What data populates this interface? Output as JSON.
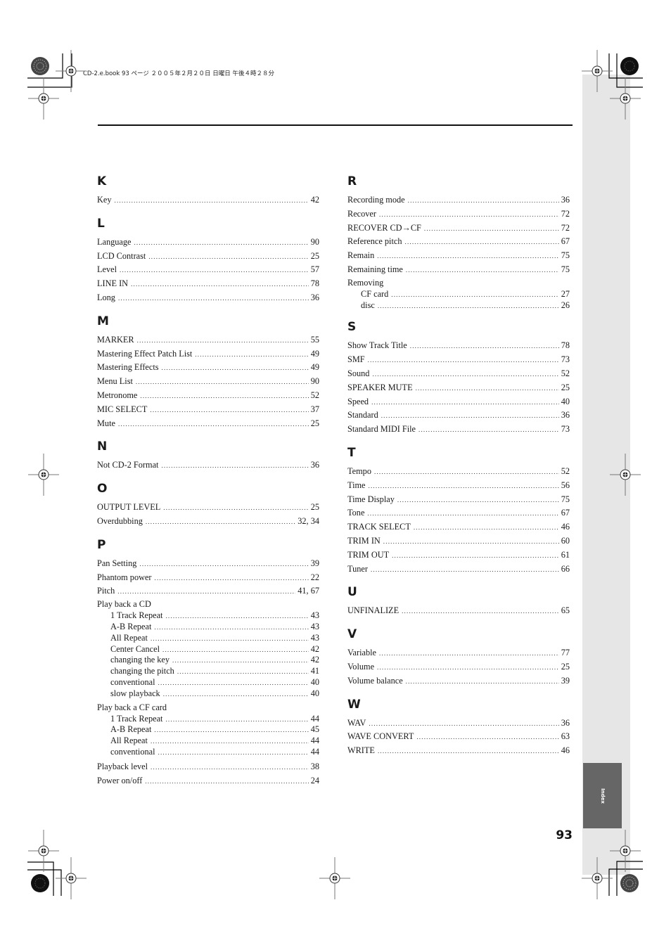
{
  "header": {
    "print_info": "CD-2.e.book  93 ページ  ２００５年２月２０日  日曜日  午後４時２８分"
  },
  "side_tab": {
    "label": "Index"
  },
  "page_number": "93",
  "index": {
    "left_column": [
      {
        "letter": "K",
        "entries": [
          {
            "label": "Key",
            "page": "42"
          }
        ]
      },
      {
        "letter": "L",
        "entries": [
          {
            "label": "Language",
            "page": "90"
          },
          {
            "label": "LCD Contrast",
            "page": "25"
          },
          {
            "label": "Level",
            "page": "57"
          },
          {
            "label": "LINE IN",
            "page": "78"
          },
          {
            "label": "Long",
            "page": "36"
          }
        ]
      },
      {
        "letter": "M",
        "entries": [
          {
            "label": "MARKER",
            "page": "55"
          },
          {
            "label": "Mastering Effect Patch List",
            "page": "49"
          },
          {
            "label": "Mastering Effects",
            "page": "49"
          },
          {
            "label": "Menu List",
            "page": "90"
          },
          {
            "label": "Metronome",
            "page": "52"
          },
          {
            "label": "MIC SELECT",
            "page": "37"
          },
          {
            "label": "Mute",
            "page": "25"
          }
        ]
      },
      {
        "letter": "N",
        "entries": [
          {
            "label": "Not CD-2 Format",
            "page": "36"
          }
        ]
      },
      {
        "letter": "O",
        "entries": [
          {
            "label": "OUTPUT LEVEL",
            "page": "25"
          },
          {
            "label": "Overdubbing",
            "page": "32, 34"
          }
        ]
      },
      {
        "letter": "P",
        "entries": [
          {
            "label": "Pan Setting",
            "page": "39"
          },
          {
            "label": "Phantom power",
            "page": "22"
          },
          {
            "label": "Pitch",
            "page": "41, 67"
          },
          {
            "label": "Play back a CD",
            "children": [
              {
                "label": "1 Track Repeat",
                "page": "43"
              },
              {
                "label": "A-B Repeat",
                "page": "43"
              },
              {
                "label": "All Repeat",
                "page": "43"
              },
              {
                "label": "Center Cancel",
                "page": "42"
              },
              {
                "label": "changing the key",
                "page": "42"
              },
              {
                "label": "changing the pitch",
                "page": "41"
              },
              {
                "label": "conventional",
                "page": "40"
              },
              {
                "label": "slow playback",
                "page": "40"
              }
            ]
          },
          {
            "label": "Play back a CF card",
            "children": [
              {
                "label": "1 Track Repeat",
                "page": "44"
              },
              {
                "label": "A-B Repeat",
                "page": "45"
              },
              {
                "label": "All Repeat",
                "page": "44"
              },
              {
                "label": "conventional",
                "page": "44"
              }
            ]
          },
          {
            "label": "Playback level",
            "page": "38"
          },
          {
            "label": "Power on/off",
            "page": "24"
          }
        ]
      }
    ],
    "right_column": [
      {
        "letter": "R",
        "entries": [
          {
            "label": "Recording mode",
            "page": "36"
          },
          {
            "label": "Recover",
            "page": "72"
          },
          {
            "label": "RECOVER CD→CF",
            "page": "72"
          },
          {
            "label": "Reference pitch",
            "page": "67"
          },
          {
            "label": "Remain",
            "page": "75"
          },
          {
            "label": "Remaining time",
            "page": "75"
          },
          {
            "label": "Removing",
            "children": [
              {
                "label": "CF card",
                "page": "27"
              },
              {
                "label": "disc",
                "page": "26"
              }
            ]
          }
        ]
      },
      {
        "letter": "S",
        "entries": [
          {
            "label": "Show Track Title",
            "page": "78"
          },
          {
            "label": "SMF",
            "page": "73"
          },
          {
            "label": "Sound",
            "page": "52"
          },
          {
            "label": "SPEAKER MUTE",
            "page": "25"
          },
          {
            "label": "Speed",
            "page": "40"
          },
          {
            "label": "Standard",
            "page": "36"
          },
          {
            "label": "Standard MIDI File",
            "page": "73"
          }
        ]
      },
      {
        "letter": "T",
        "entries": [
          {
            "label": "Tempo",
            "page": "52"
          },
          {
            "label": "Time",
            "page": "56"
          },
          {
            "label": "Time Display",
            "page": "75"
          },
          {
            "label": "Tone",
            "page": "67"
          },
          {
            "label": "TRACK SELECT",
            "page": "46"
          },
          {
            "label": "TRIM IN",
            "page": "60"
          },
          {
            "label": "TRIM OUT",
            "page": "61"
          },
          {
            "label": "Tuner",
            "page": "66"
          }
        ]
      },
      {
        "letter": "U",
        "entries": [
          {
            "label": "UNFINALIZE",
            "page": "65"
          }
        ]
      },
      {
        "letter": "V",
        "entries": [
          {
            "label": "Variable",
            "page": "77"
          },
          {
            "label": "Volume",
            "page": "25"
          },
          {
            "label": "Volume balance",
            "page": "39"
          }
        ]
      },
      {
        "letter": "W",
        "entries": [
          {
            "label": "WAV",
            "page": "36"
          },
          {
            "label": "WAVE CONVERT",
            "page": "63"
          },
          {
            "label": "WRITE",
            "page": "46"
          }
        ]
      }
    ]
  }
}
